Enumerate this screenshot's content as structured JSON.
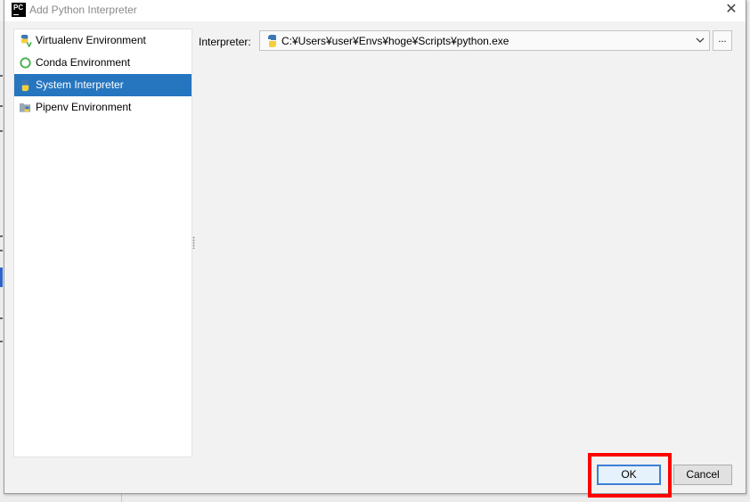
{
  "window": {
    "title": "Add Python Interpreter",
    "app_icon_text": "PC",
    "close_glyph": "✕"
  },
  "sidebar": {
    "items": [
      {
        "label": "Virtualenv Environment",
        "icon": "virtualenv-icon",
        "selected": false
      },
      {
        "label": "Conda Environment",
        "icon": "conda-icon",
        "selected": false
      },
      {
        "label": "System Interpreter",
        "icon": "python-icon",
        "selected": true
      },
      {
        "label": "Pipenv Environment",
        "icon": "pipenv-icon",
        "selected": false
      }
    ]
  },
  "interpreter": {
    "label": "Interpreter:",
    "value": "C:¥Users¥user¥Envs¥hoge¥Scripts¥python.exe",
    "browse_label": "..."
  },
  "buttons": {
    "ok": "OK",
    "cancel": "Cancel"
  },
  "colors": {
    "selection": "#2675bf",
    "highlight_annotation": "#ff0000",
    "python_blue": "#3d78b3",
    "python_yellow": "#f5d03b",
    "conda_green": "#43b049"
  }
}
